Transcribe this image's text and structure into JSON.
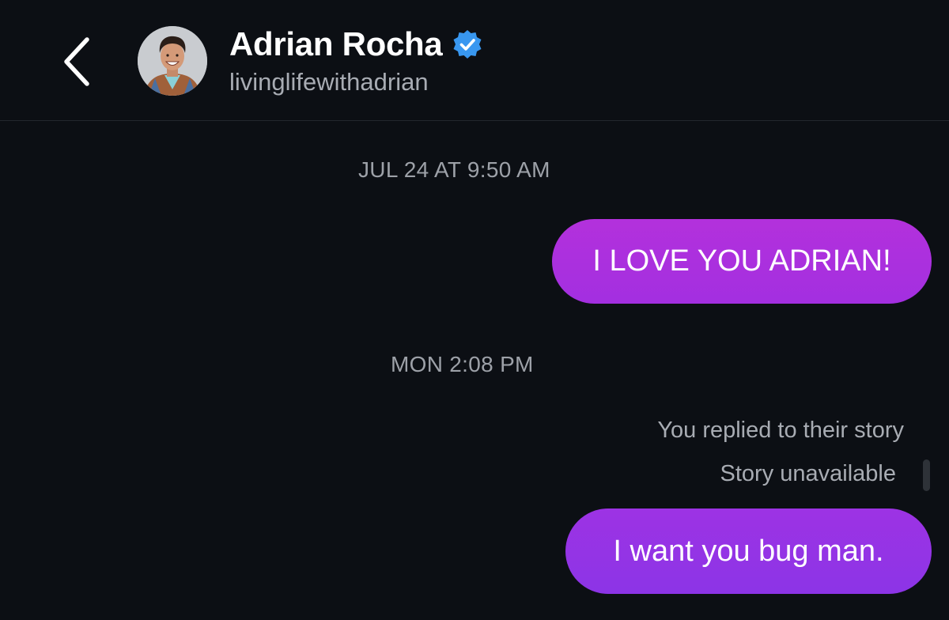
{
  "header": {
    "back_icon": "chevron-left-icon",
    "contact_name": "Adrian Rocha",
    "verified_icon": "verified-badge-icon",
    "username": "livinglifewithadrian",
    "verified_color": "#3897f0"
  },
  "messages": {
    "timestamp_1": "JUL 24 AT 9:50 AM",
    "message_1": "I LOVE YOU ADRIAN!",
    "timestamp_2": "MON 2:08 PM",
    "story_reply_label": "You replied to their story",
    "story_unavailable_label": "Story unavailable",
    "message_2": "I want you bug man."
  },
  "colors": {
    "background": "#0c0f14",
    "bubble_top": "#b331dc",
    "bubble_bottom": "#8c34e6"
  }
}
